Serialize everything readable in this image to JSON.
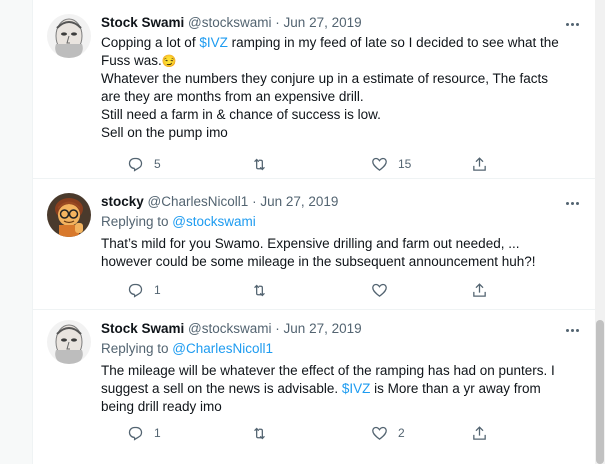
{
  "tweets": [
    {
      "name": "Stock Swami",
      "handle": "@stockswami",
      "sep": "·",
      "date": "Jun 27, 2019",
      "line1_pre": "Copping a lot of ",
      "line1_link": "$IVZ",
      "line1_post": " ramping in my feed of late so I decided to see what the Fuss was.",
      "emoji": "😏",
      "line2": "Whatever the numbers they conjure up in a estimate of  resource, The facts are they are months from an expensive drill.",
      "line3": "Still need a farm in & chance of success is low.",
      "line4": "Sell on the pump imo",
      "reply_count": "5",
      "retweet_count": "",
      "like_count": "15"
    },
    {
      "name": "stocky",
      "handle": "@CharlesNicoll1",
      "sep": "·",
      "date": "Jun 27, 2019",
      "replying_label": "Replying to ",
      "replying_to": "@stockswami",
      "body": "That’s mild for you Swamo. Expensive drilling and farm out needed, ... however could be some mileage in the subsequent announcement huh?!",
      "reply_count": "1",
      "retweet_count": "",
      "like_count": ""
    },
    {
      "name": "Stock Swami",
      "handle": "@stockswami",
      "sep": "·",
      "date": "Jun 27, 2019",
      "replying_label": "Replying to ",
      "replying_to": "@CharlesNicoll1",
      "body_pre": "The mileage will be whatever the effect of the ramping has had on punters. I suggest a sell on the news is advisable. ",
      "body_link": "$IVZ",
      "body_post": " is More than a yr away from being drill ready imo",
      "reply_count": "1",
      "retweet_count": "",
      "like_count": "2"
    }
  ],
  "icons": [
    "reply-icon",
    "retweet-icon",
    "like-icon",
    "share-icon",
    "more-icon"
  ],
  "colors": {
    "link": "#1d9bf0",
    "secondary": "#536471",
    "text": "#0f1419"
  }
}
